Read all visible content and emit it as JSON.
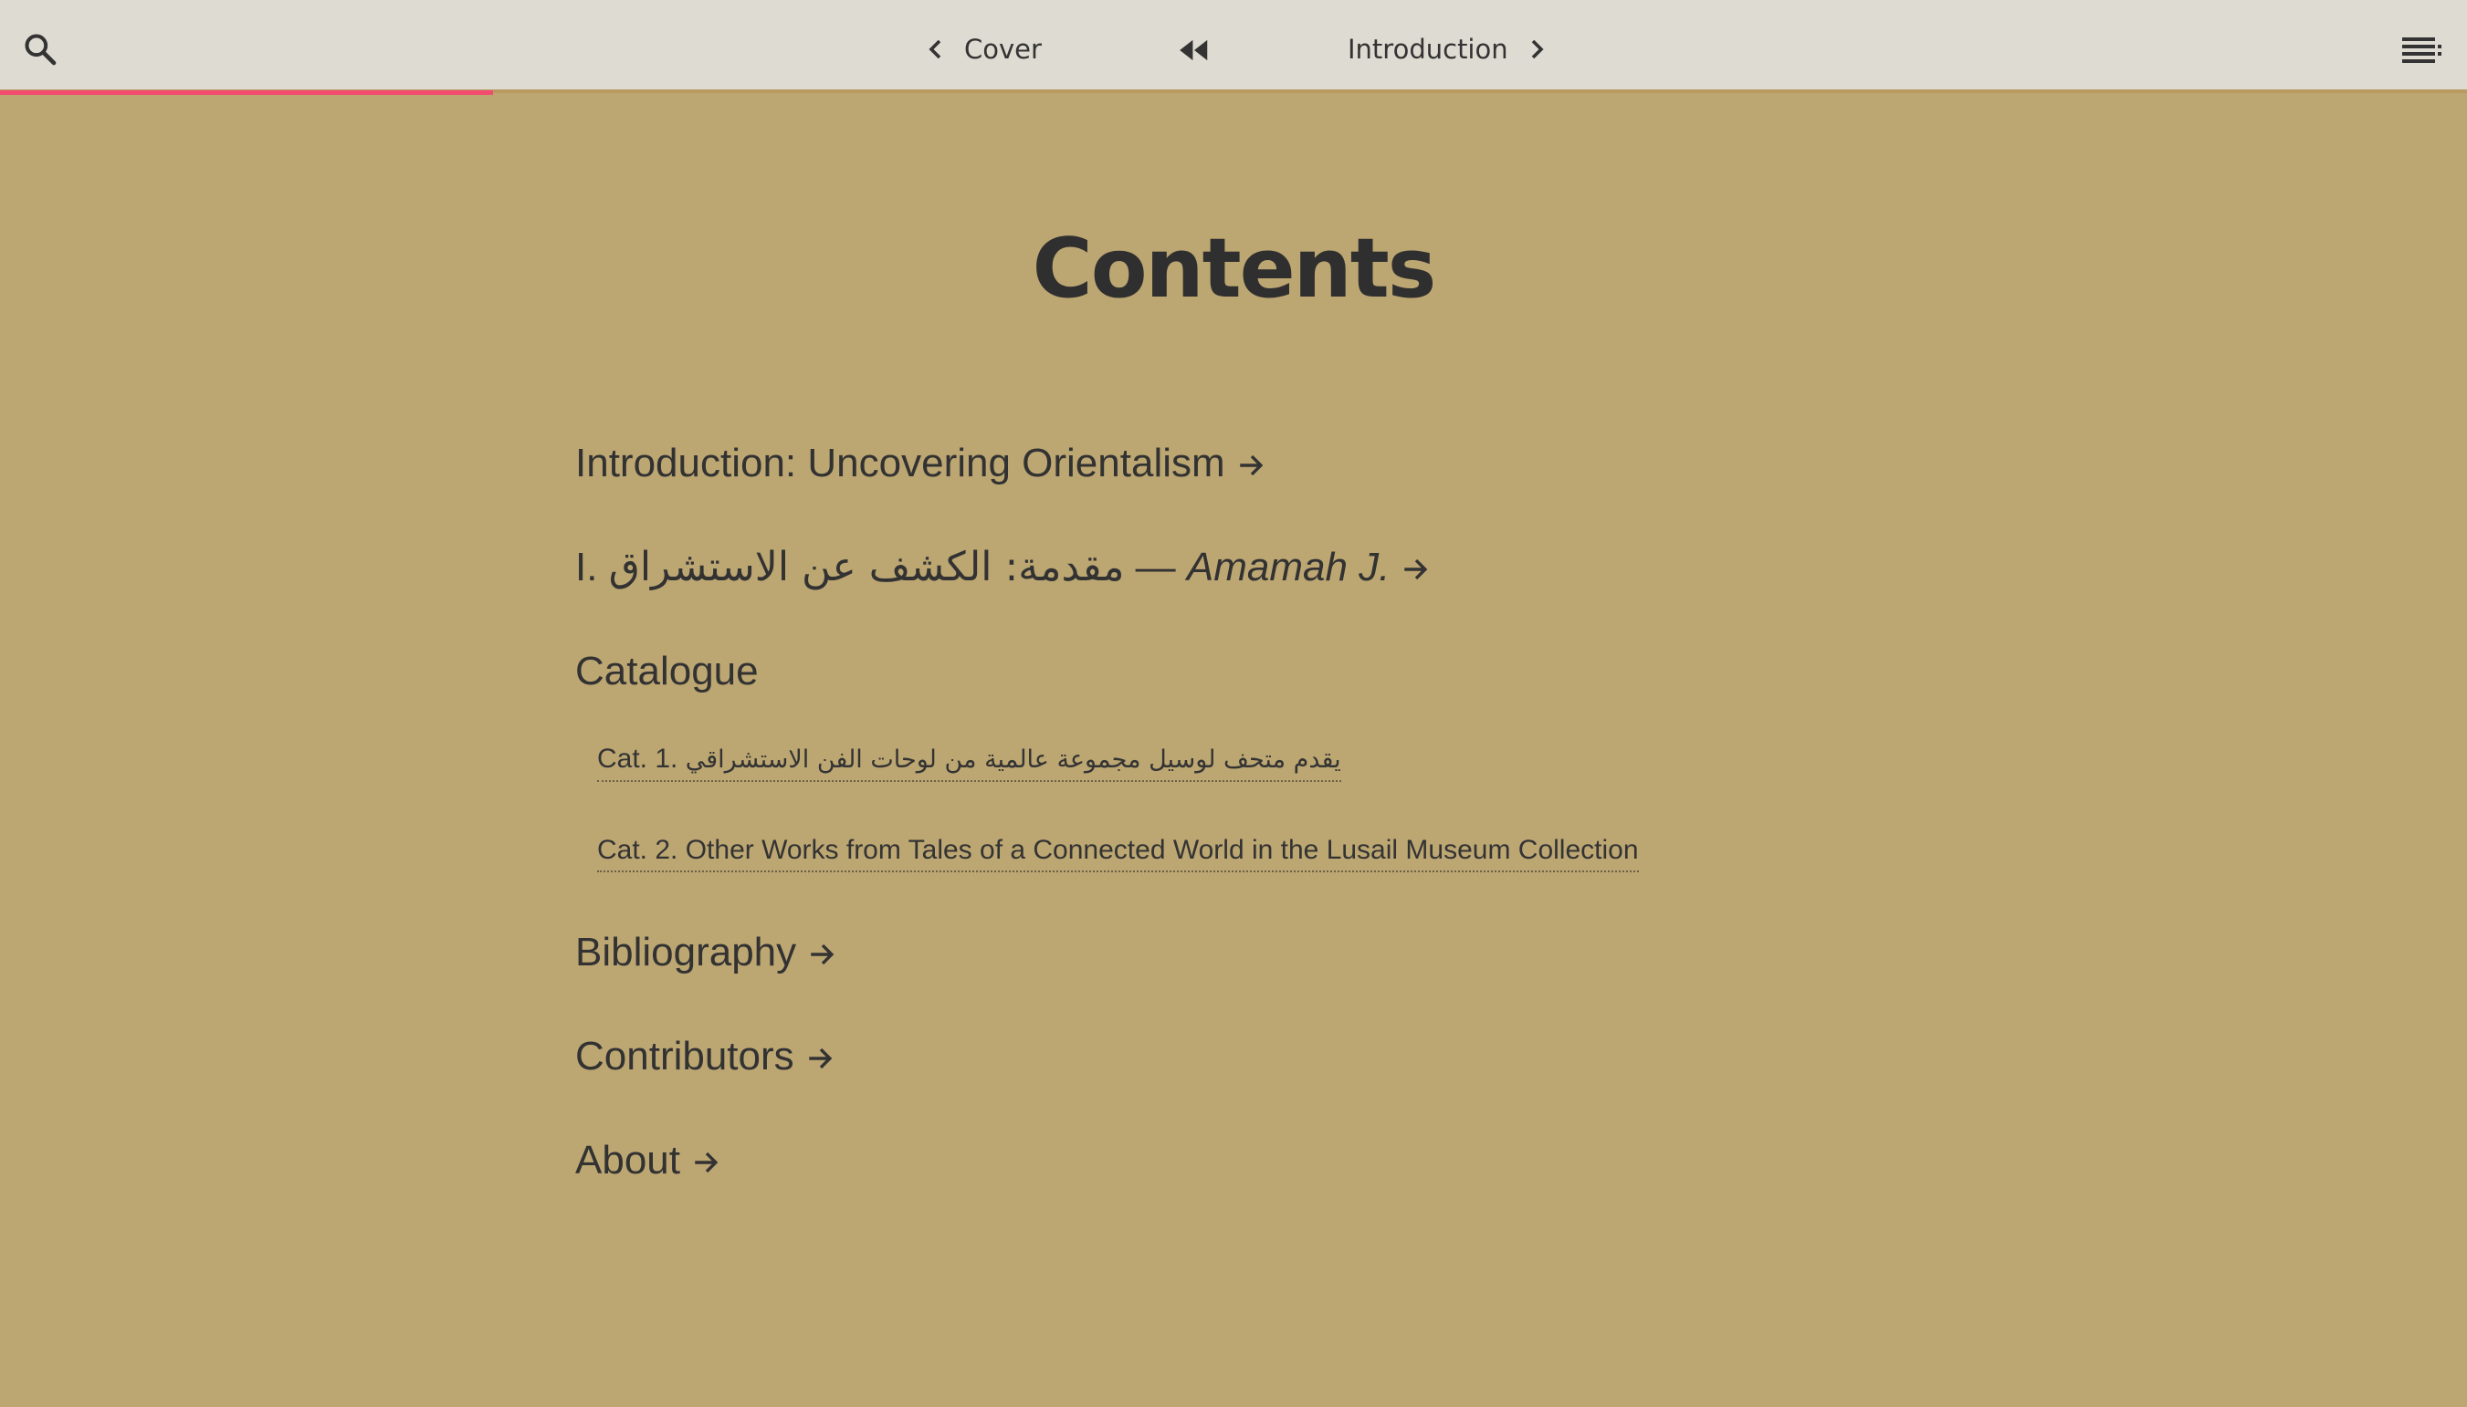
{
  "nav": {
    "prev_label": "Cover",
    "next_label": "Introduction"
  },
  "page": {
    "title": "Contents"
  },
  "toc": {
    "intro": "Introduction: Uncovering Orientalism",
    "arabic_intro_prefix": "I. ",
    "arabic_intro_text": "مقدمة: الكشف عن الاستشراق",
    "arabic_intro_sep": " — ",
    "arabic_intro_author": "Amamah J.",
    "catalogue": "Catalogue",
    "cat1_prefix": "Cat. 1. ",
    "cat1_text": "يقدم متحف لوسيل مجموعة عالمية من لوحات الفن الاستشراقي",
    "cat2": "Cat. 2. Other Works from Tales of a Connected World in the Lusail Museum Collection",
    "bibliography": "Bibliography",
    "contributors": "Contributors",
    "about": "About"
  },
  "icons": {
    "search": "search-icon",
    "menu": "menu-icon",
    "prev": "chevron-left-icon",
    "next": "chevron-right-icon",
    "rewind": "rewind-icon",
    "arrow": "arrow-right-icon"
  },
  "colors": {
    "background": "#bca672",
    "topbar": "#dedbd2",
    "progress": "#f24d6e",
    "text": "#2f2f2f"
  },
  "progress": {
    "fraction": 0.2
  }
}
